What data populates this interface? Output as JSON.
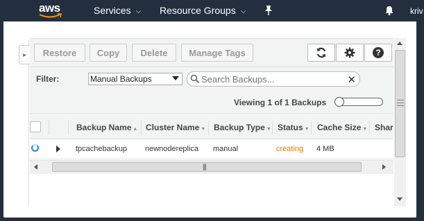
{
  "topnav": {
    "logo": "aws",
    "services_label": "Services",
    "resource_groups_label": "Resource Groups",
    "user_label": "kriv",
    "chevron_icon": "chevron-down-icon",
    "pin_icon": "pin-icon",
    "bell_icon": "bell-icon"
  },
  "toolbar": {
    "restore_label": "Restore",
    "copy_label": "Copy",
    "delete_label": "Delete",
    "manage_tags_label": "Manage Tags",
    "icons": [
      "refresh-icon",
      "gear-icon",
      "help-icon"
    ],
    "help_glyph": "?"
  },
  "filter": {
    "label": "Filter:",
    "selected": "Manual Backups",
    "search_placeholder": "Search Backups..."
  },
  "viewing": {
    "text": "Viewing 1 of 1 Backups"
  },
  "table": {
    "columns": [
      "Backup Name",
      "Cluster Name",
      "Backup Type",
      "Status",
      "Cache Size",
      "Shar"
    ],
    "rows": [
      {
        "backup_name": "tpcachebackup",
        "cluster_name": "newnodereplica",
        "backup_type": "manual",
        "status": "creating",
        "cache_size": "4 MB"
      }
    ]
  },
  "colors": {
    "nav_bg": "#232f3e",
    "status_creating": "#e07b00",
    "spinner": "#1e88e5"
  }
}
